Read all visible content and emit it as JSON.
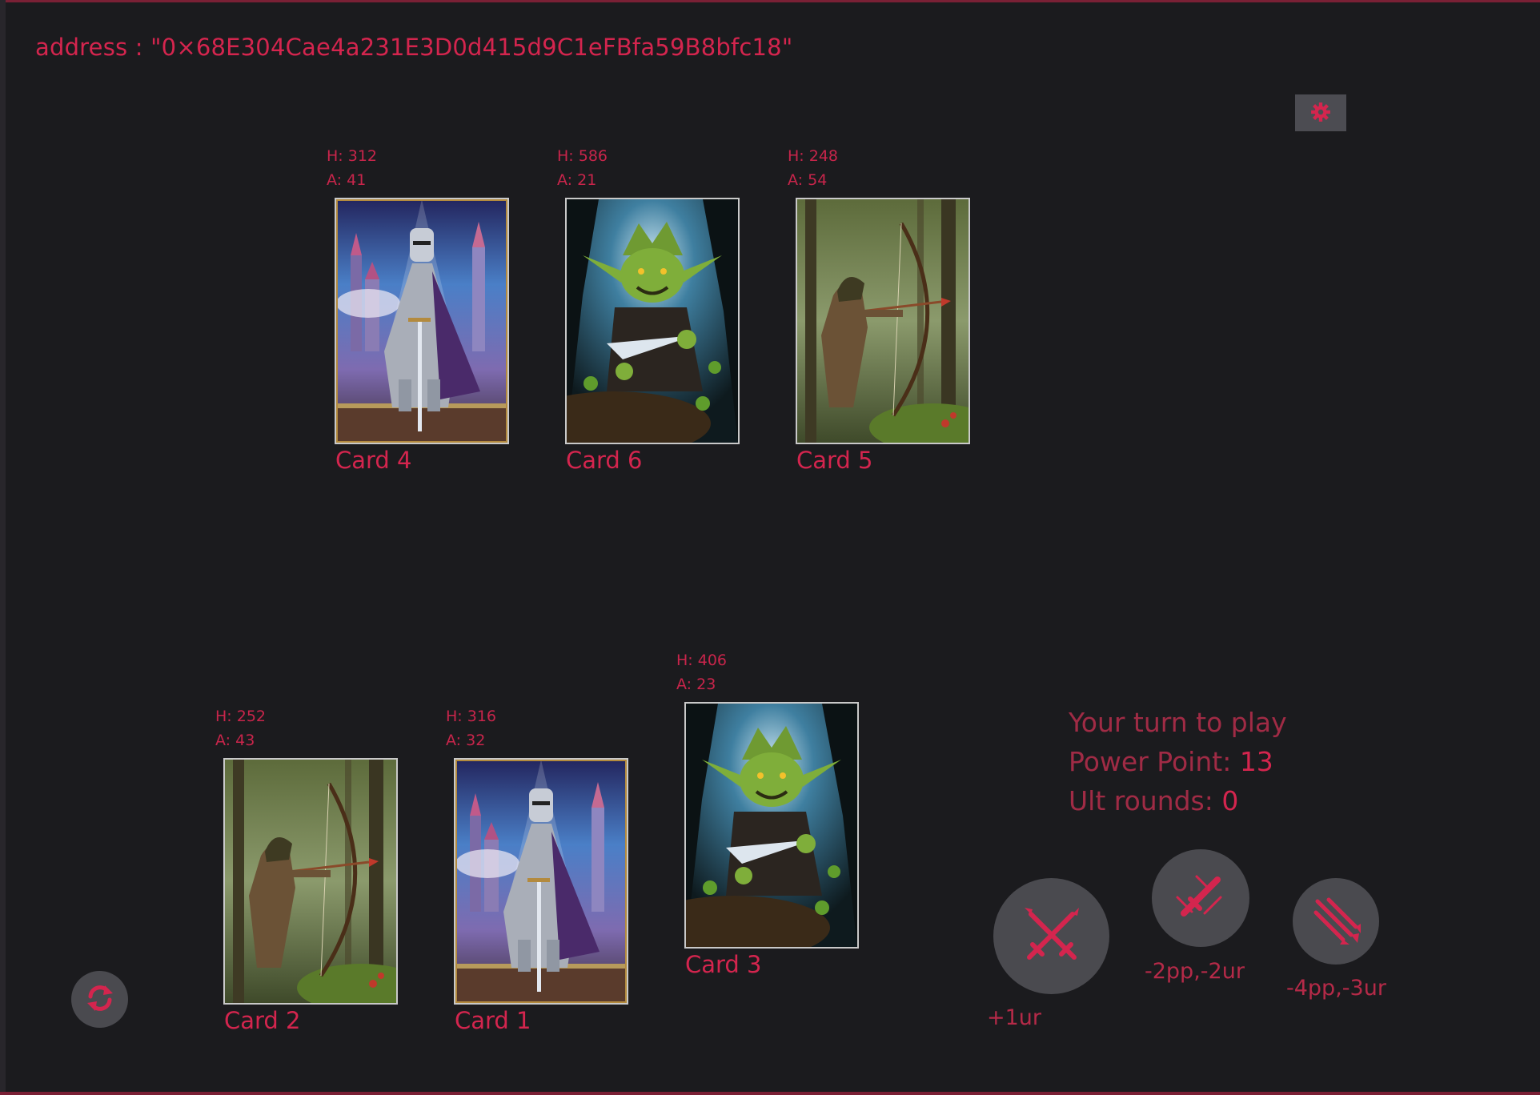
{
  "header": {
    "address": "address : \"0×68E304Cae4a231E3D0d415d9C1eFBfa59B8bfc18\""
  },
  "settings": {
    "icon": "gear-icon"
  },
  "opponent_cards": [
    {
      "name": "Card 4",
      "health": "H: 312",
      "attack": "A: 41",
      "type": "knight"
    },
    {
      "name": "Card 6",
      "health": "H: 586",
      "attack": "A: 21",
      "type": "goblin"
    },
    {
      "name": "Card 5",
      "health": "H: 248",
      "attack": "A: 54",
      "type": "archer"
    }
  ],
  "player_cards": [
    {
      "name": "Card 2",
      "health": "H: 252",
      "attack": "A: 43",
      "type": "archer"
    },
    {
      "name": "Card 1",
      "health": "H: 316",
      "attack": "A: 32",
      "type": "knight"
    },
    {
      "name": "Card 3",
      "health": "H: 406",
      "attack": "A: 23",
      "type": "goblin"
    }
  ],
  "status": {
    "turn": "Your turn to play",
    "power_label": "Power Point: ",
    "power_value": "13",
    "ult_label": "Ult rounds: ",
    "ult_value": "0"
  },
  "actions": [
    {
      "label": "+1ur",
      "icon": "crossed-swords-icon"
    },
    {
      "label": "-2pp,-2ur",
      "icon": "sword-strike-icon"
    },
    {
      "label": "-4pp,-3ur",
      "icon": "arrow-volley-icon"
    }
  ],
  "refresh": {
    "icon": "refresh-icon"
  },
  "colors": {
    "accent": "#d4254e",
    "background": "#1b1b1e",
    "button": "#4a4a4f"
  }
}
